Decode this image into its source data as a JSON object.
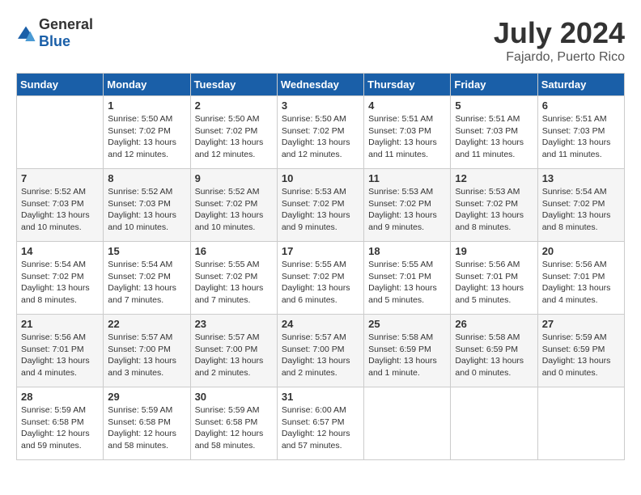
{
  "header": {
    "logo_general": "General",
    "logo_blue": "Blue",
    "month_year": "July 2024",
    "location": "Fajardo, Puerto Rico"
  },
  "days_of_week": [
    "Sunday",
    "Monday",
    "Tuesday",
    "Wednesday",
    "Thursday",
    "Friday",
    "Saturday"
  ],
  "weeks": [
    [
      {
        "num": "",
        "info": ""
      },
      {
        "num": "1",
        "info": "Sunrise: 5:50 AM\nSunset: 7:02 PM\nDaylight: 13 hours and 12 minutes."
      },
      {
        "num": "2",
        "info": "Sunrise: 5:50 AM\nSunset: 7:02 PM\nDaylight: 13 hours and 12 minutes."
      },
      {
        "num": "3",
        "info": "Sunrise: 5:50 AM\nSunset: 7:02 PM\nDaylight: 13 hours and 12 minutes."
      },
      {
        "num": "4",
        "info": "Sunrise: 5:51 AM\nSunset: 7:03 PM\nDaylight: 13 hours and 11 minutes."
      },
      {
        "num": "5",
        "info": "Sunrise: 5:51 AM\nSunset: 7:03 PM\nDaylight: 13 hours and 11 minutes."
      },
      {
        "num": "6",
        "info": "Sunrise: 5:51 AM\nSunset: 7:03 PM\nDaylight: 13 hours and 11 minutes."
      }
    ],
    [
      {
        "num": "7",
        "info": "Sunrise: 5:52 AM\nSunset: 7:03 PM\nDaylight: 13 hours and 10 minutes."
      },
      {
        "num": "8",
        "info": "Sunrise: 5:52 AM\nSunset: 7:03 PM\nDaylight: 13 hours and 10 minutes."
      },
      {
        "num": "9",
        "info": "Sunrise: 5:52 AM\nSunset: 7:02 PM\nDaylight: 13 hours and 10 minutes."
      },
      {
        "num": "10",
        "info": "Sunrise: 5:53 AM\nSunset: 7:02 PM\nDaylight: 13 hours and 9 minutes."
      },
      {
        "num": "11",
        "info": "Sunrise: 5:53 AM\nSunset: 7:02 PM\nDaylight: 13 hours and 9 minutes."
      },
      {
        "num": "12",
        "info": "Sunrise: 5:53 AM\nSunset: 7:02 PM\nDaylight: 13 hours and 8 minutes."
      },
      {
        "num": "13",
        "info": "Sunrise: 5:54 AM\nSunset: 7:02 PM\nDaylight: 13 hours and 8 minutes."
      }
    ],
    [
      {
        "num": "14",
        "info": "Sunrise: 5:54 AM\nSunset: 7:02 PM\nDaylight: 13 hours and 8 minutes."
      },
      {
        "num": "15",
        "info": "Sunrise: 5:54 AM\nSunset: 7:02 PM\nDaylight: 13 hours and 7 minutes."
      },
      {
        "num": "16",
        "info": "Sunrise: 5:55 AM\nSunset: 7:02 PM\nDaylight: 13 hours and 7 minutes."
      },
      {
        "num": "17",
        "info": "Sunrise: 5:55 AM\nSunset: 7:02 PM\nDaylight: 13 hours and 6 minutes."
      },
      {
        "num": "18",
        "info": "Sunrise: 5:55 AM\nSunset: 7:01 PM\nDaylight: 13 hours and 5 minutes."
      },
      {
        "num": "19",
        "info": "Sunrise: 5:56 AM\nSunset: 7:01 PM\nDaylight: 13 hours and 5 minutes."
      },
      {
        "num": "20",
        "info": "Sunrise: 5:56 AM\nSunset: 7:01 PM\nDaylight: 13 hours and 4 minutes."
      }
    ],
    [
      {
        "num": "21",
        "info": "Sunrise: 5:56 AM\nSunset: 7:01 PM\nDaylight: 13 hours and 4 minutes."
      },
      {
        "num": "22",
        "info": "Sunrise: 5:57 AM\nSunset: 7:00 PM\nDaylight: 13 hours and 3 minutes."
      },
      {
        "num": "23",
        "info": "Sunrise: 5:57 AM\nSunset: 7:00 PM\nDaylight: 13 hours and 2 minutes."
      },
      {
        "num": "24",
        "info": "Sunrise: 5:57 AM\nSunset: 7:00 PM\nDaylight: 13 hours and 2 minutes."
      },
      {
        "num": "25",
        "info": "Sunrise: 5:58 AM\nSunset: 6:59 PM\nDaylight: 13 hours and 1 minute."
      },
      {
        "num": "26",
        "info": "Sunrise: 5:58 AM\nSunset: 6:59 PM\nDaylight: 13 hours and 0 minutes."
      },
      {
        "num": "27",
        "info": "Sunrise: 5:59 AM\nSunset: 6:59 PM\nDaylight: 13 hours and 0 minutes."
      }
    ],
    [
      {
        "num": "28",
        "info": "Sunrise: 5:59 AM\nSunset: 6:58 PM\nDaylight: 12 hours and 59 minutes."
      },
      {
        "num": "29",
        "info": "Sunrise: 5:59 AM\nSunset: 6:58 PM\nDaylight: 12 hours and 58 minutes."
      },
      {
        "num": "30",
        "info": "Sunrise: 5:59 AM\nSunset: 6:58 PM\nDaylight: 12 hours and 58 minutes."
      },
      {
        "num": "31",
        "info": "Sunrise: 6:00 AM\nSunset: 6:57 PM\nDaylight: 12 hours and 57 minutes."
      },
      {
        "num": "",
        "info": ""
      },
      {
        "num": "",
        "info": ""
      },
      {
        "num": "",
        "info": ""
      }
    ]
  ]
}
